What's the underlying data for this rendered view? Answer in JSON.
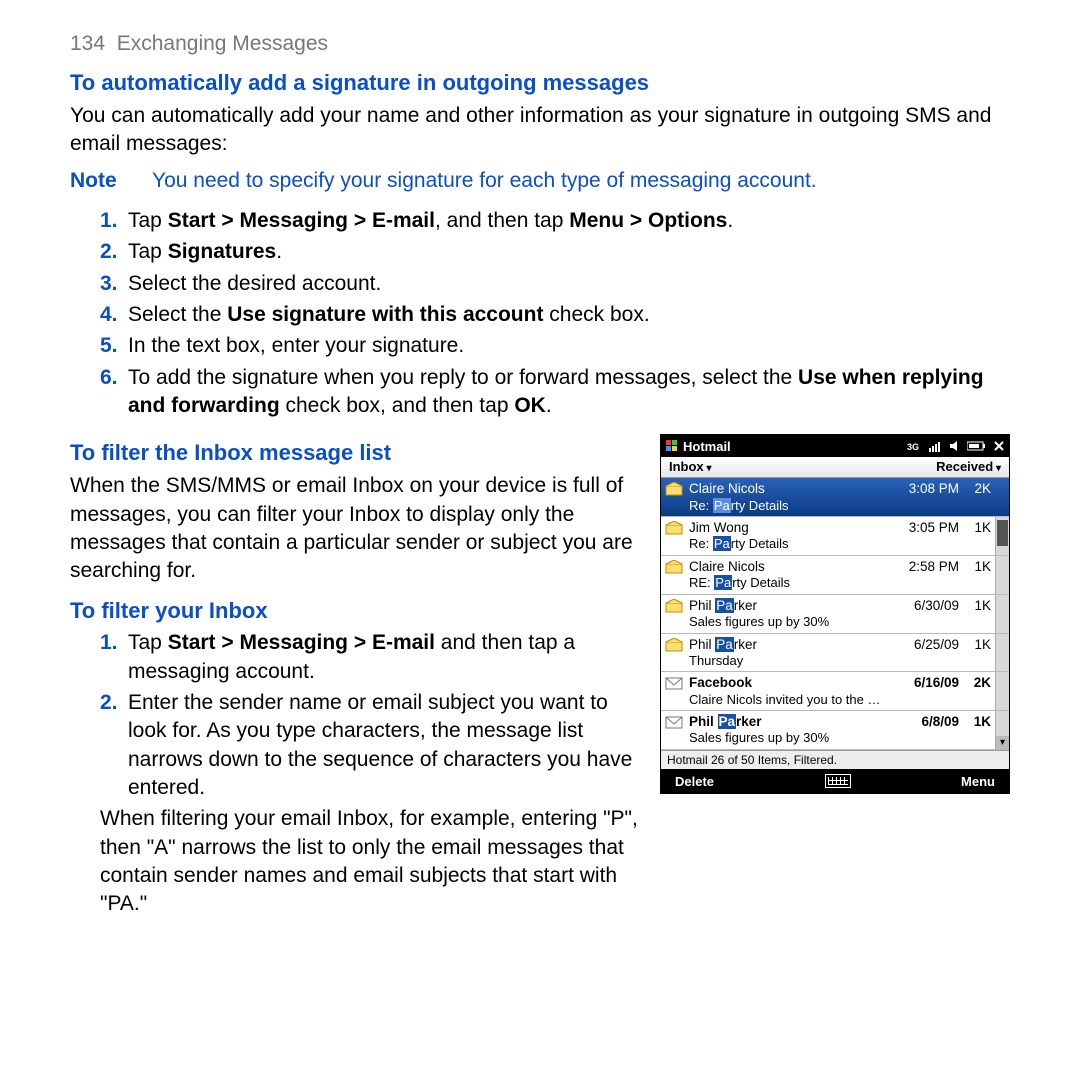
{
  "page": {
    "number": "134",
    "section": "Exchanging Messages"
  },
  "h_signature": "To automatically add a signature in outgoing messages",
  "p_signature": "You can automatically add your name and other information as your signature in outgoing SMS and email messages:",
  "note": {
    "label": "Note",
    "text": "You need to specify your signature for each type of messaging account."
  },
  "steps_sig": [
    {
      "n": "1.",
      "html": "Tap <strong>Start &gt; Messaging &gt; E-mail</strong>, and then tap <strong>Menu &gt; Options</strong>."
    },
    {
      "n": "2.",
      "html": "Tap <strong>Signatures</strong>."
    },
    {
      "n": "3.",
      "html": "Select the desired account."
    },
    {
      "n": "4.",
      "html": "Select the <strong>Use signature with this account</strong> check box."
    },
    {
      "n": "5.",
      "html": "In the text box, enter your signature."
    },
    {
      "n": "6.",
      "html": "To add the signature when you reply to or forward messages, select the <strong>Use when replying and forwarding</strong> check box, and then tap <strong>OK</strong>."
    }
  ],
  "h_filter_list": "To filter the Inbox message list",
  "p_filter_list": "When the SMS/MMS or email Inbox on your device is full of messages, you can filter your Inbox to display only the messages that contain a particular sender or subject you are searching for.",
  "h_filter_inbox": "To filter your Inbox",
  "steps_filter": [
    {
      "n": "1.",
      "html": "Tap <strong>Start &gt; Messaging &gt; E-mail</strong> and then tap a messaging account."
    },
    {
      "n": "2.",
      "html": "Enter the sender name or email subject you want to look for. As you type characters, the message list narrows down to the sequence of characters you have entered."
    }
  ],
  "p_filter_extra": "When filtering your email Inbox, for example, entering \"P\", then \"A\" narrows the list to only the email messages that contain sender names and email subjects that start with \"PA.\"",
  "phone": {
    "title": "Hotmail",
    "folder": "Inbox",
    "sort": "Received",
    "status": "Hotmail  26 of 50 Items, Filtered.",
    "softkeys": {
      "left": "Delete",
      "right": "Menu"
    },
    "messages": [
      {
        "icon": "open-mail",
        "sender": "Claire Nicols",
        "time": "3:08 PM",
        "size": "2K",
        "subject_pre": "Re: ",
        "subject_hl": "Pa",
        "subject_post": "rty Details",
        "selected": true,
        "bold": false
      },
      {
        "icon": "open-mail",
        "sender": "Jim Wong",
        "time": "3:05 PM",
        "size": "1K",
        "subject_pre": "Re: ",
        "subject_hl": "Pa",
        "subject_post": "rty Details",
        "selected": false,
        "bold": false
      },
      {
        "icon": "open-mail",
        "sender": "Claire Nicols",
        "time": "2:58 PM",
        "size": "1K",
        "subject_pre": "RE: ",
        "subject_hl": "Pa",
        "subject_post": "rty Details",
        "selected": false,
        "bold": false
      },
      {
        "icon": "open-mail",
        "sender_pre": "Phil ",
        "sender_hl": "Pa",
        "sender_post": "rker",
        "time": "6/30/09",
        "size": "1K",
        "subject": "Sales figures up by 30%",
        "selected": false,
        "bold": false
      },
      {
        "icon": "open-mail",
        "sender_pre": "Phil ",
        "sender_hl": "Pa",
        "sender_post": "rker",
        "time": "6/25/09",
        "size": "1K",
        "subject": "Thursday",
        "selected": false,
        "bold": false
      },
      {
        "icon": "closed-mail",
        "sender": "Facebook",
        "time": "6/16/09",
        "size": "2K",
        "subject": "Claire Nicols invited you to the …",
        "selected": false,
        "bold": true
      },
      {
        "icon": "closed-mail",
        "sender_pre": "Phil ",
        "sender_hl": "Pa",
        "sender_post": "rker",
        "time": "6/8/09",
        "size": "1K",
        "subject": "Sales figures up by 30%",
        "selected": false,
        "bold": true
      }
    ]
  }
}
